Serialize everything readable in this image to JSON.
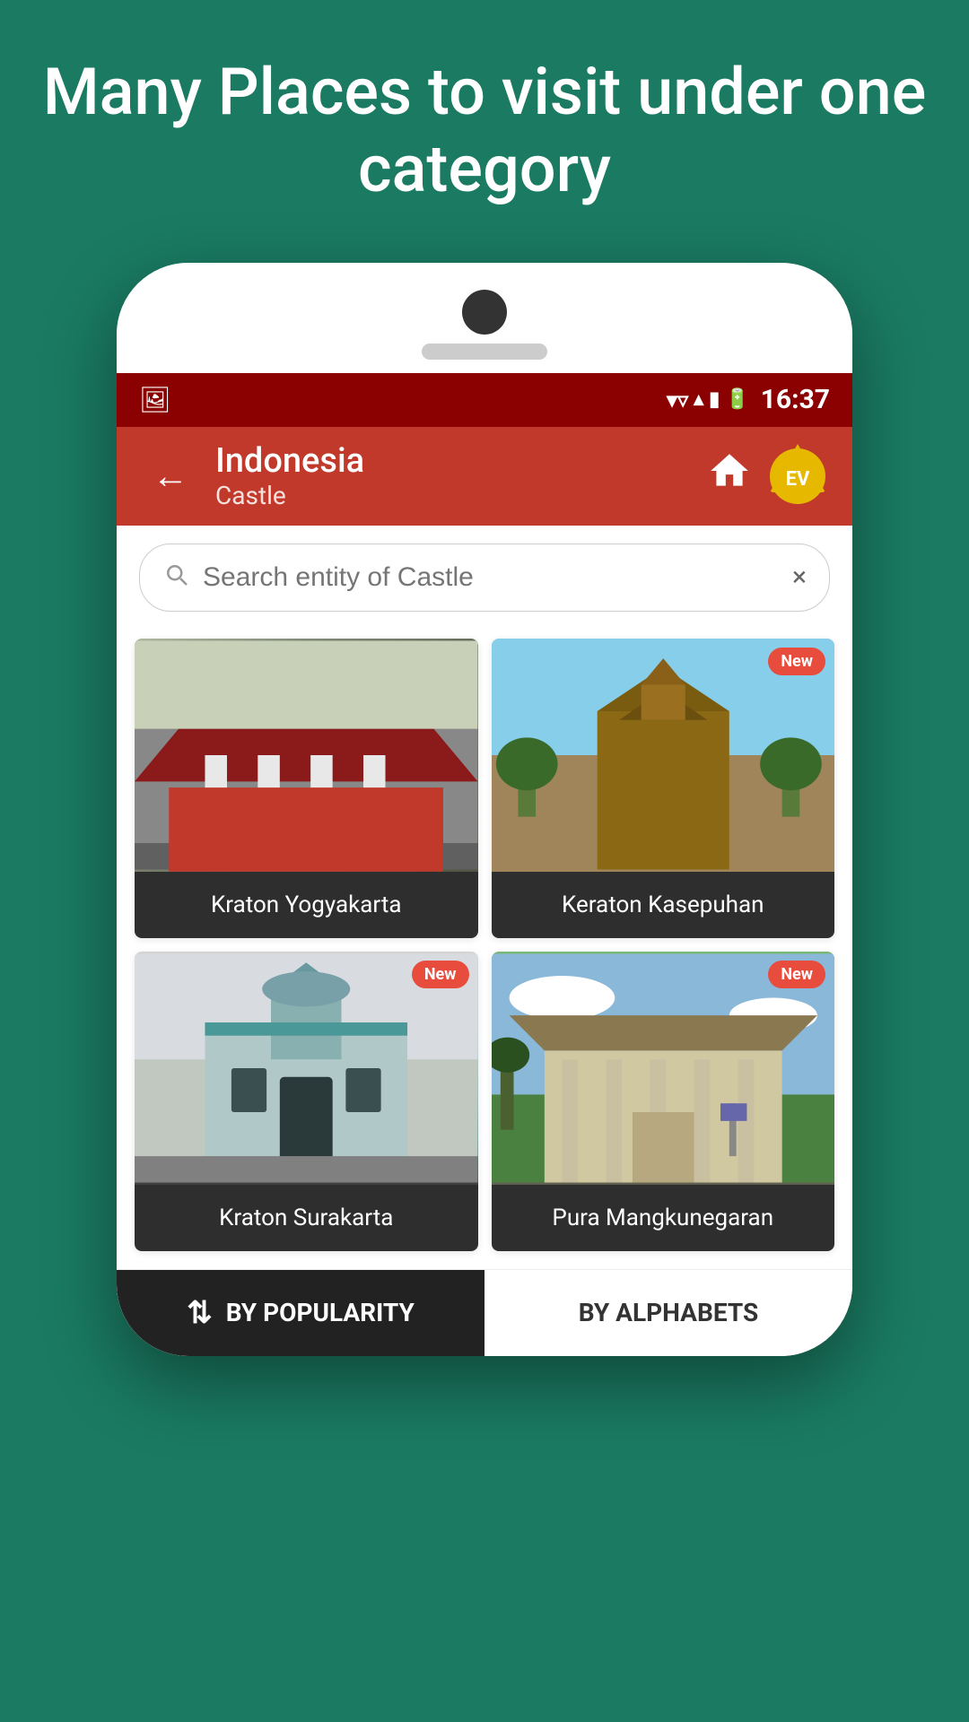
{
  "page": {
    "header_title": "Many Places to visit under one category",
    "background_color": "#1a7a62"
  },
  "status_bar": {
    "time": "16:37"
  },
  "toolbar": {
    "title": "Indonesia",
    "subtitle": "Castle",
    "back_label": "←"
  },
  "search": {
    "placeholder": "Search entity of Castle",
    "clear_label": "×"
  },
  "places": [
    {
      "id": "kraton-yogyakarta",
      "name": "Kraton Yogyakarta",
      "is_new": false,
      "img_class": "img-kraton-yogya"
    },
    {
      "id": "keraton-kasepuhan",
      "name": "Keraton Kasepuhan",
      "is_new": true,
      "img_class": "img-keraton-kasepuhan"
    },
    {
      "id": "kraton-surakarta",
      "name": "Kraton Surakarta",
      "is_new": true,
      "img_class": "img-kraton-surakarta"
    },
    {
      "id": "pura-mangkunegaran",
      "name": "Pura Mangkunegaran",
      "is_new": true,
      "img_class": "img-pura-mangku"
    }
  ],
  "bottom_bar": {
    "sort_by_popularity_label": "BY POPULARITY",
    "sort_by_alphabets_label": "BY ALPHABETS",
    "sort_icon": "⇅",
    "active_tab": "popularity"
  },
  "badges": {
    "new_label": "New"
  },
  "ev_logo": {
    "text": "EV"
  }
}
